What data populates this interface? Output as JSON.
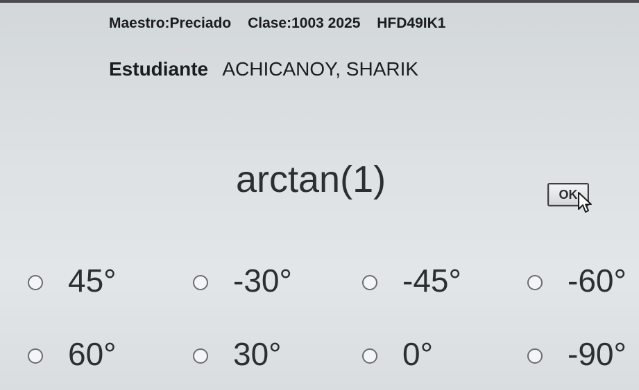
{
  "header": {
    "teacher": "Maestro:Preciado",
    "class": "Clase:1003 2025",
    "code": "HFD49IK1"
  },
  "student": {
    "label": "Estudiante",
    "name": "ACHICANOY, SHARIK"
  },
  "question": {
    "text": "arctan(1)"
  },
  "ok_button": {
    "label": "OK"
  },
  "options": [
    {
      "label": "45°"
    },
    {
      "label": "-30°"
    },
    {
      "label": "-45°"
    },
    {
      "label": "-60°"
    },
    {
      "label": "60°"
    },
    {
      "label": "30°"
    },
    {
      "label": "0°"
    },
    {
      "label": "-90°"
    }
  ]
}
